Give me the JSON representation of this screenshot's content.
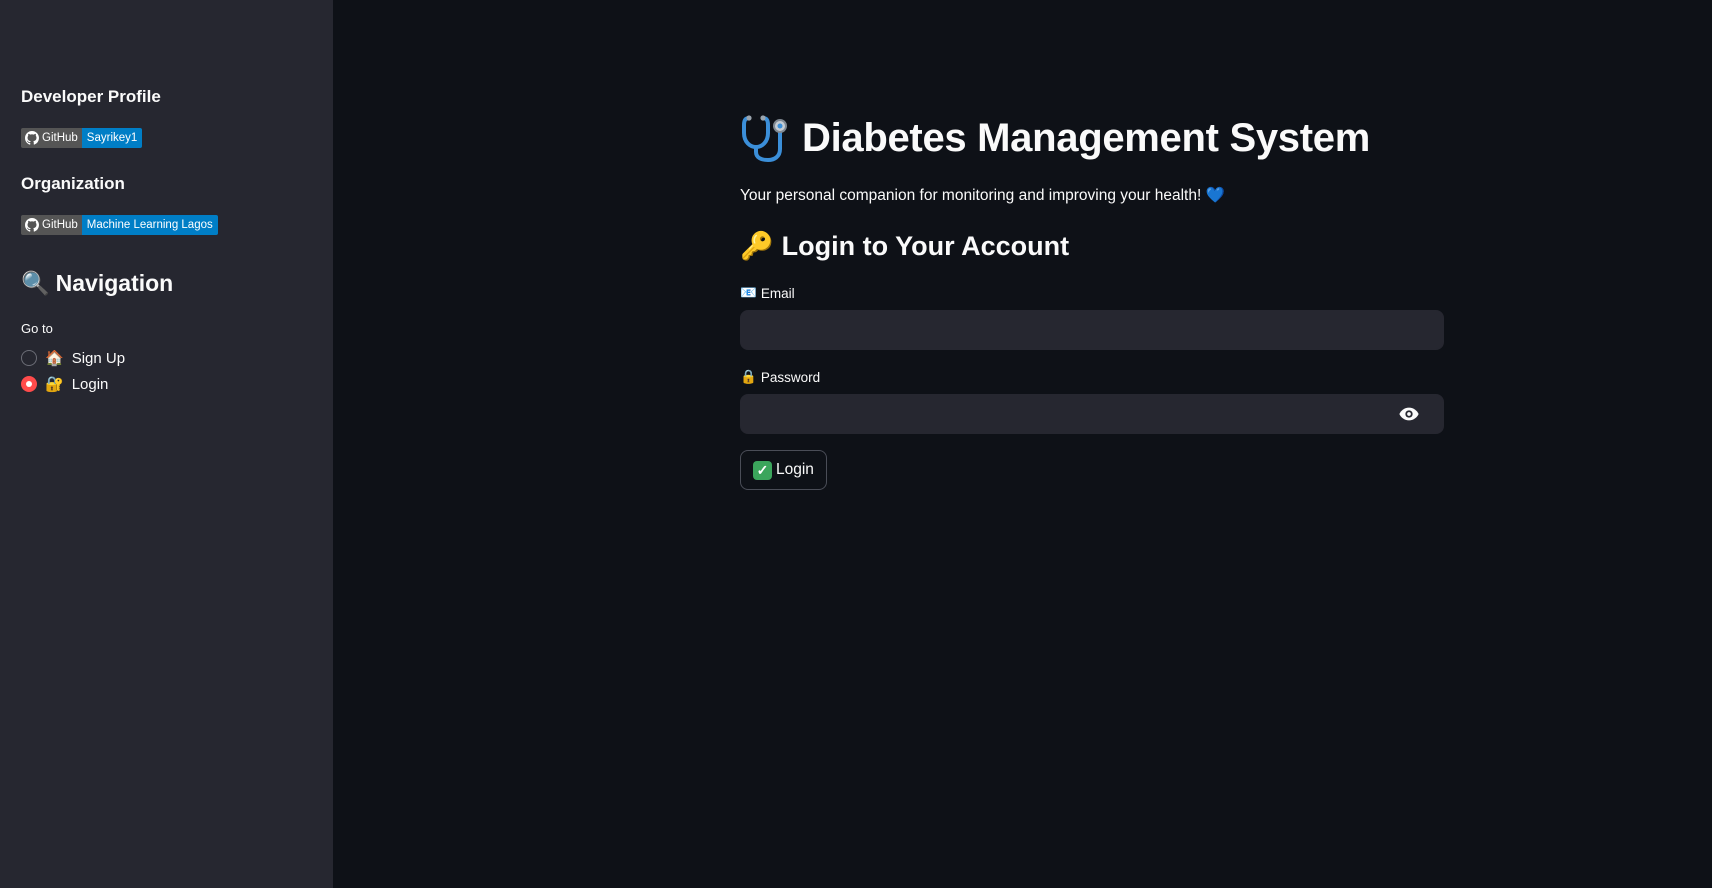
{
  "sidebar": {
    "developer_heading": "Developer Profile",
    "developer_badge": {
      "label": "GitHub",
      "value": "Sayrikey1"
    },
    "org_heading": "Organization",
    "org_badge": {
      "label": "GitHub",
      "value": "Machine Learning Lagos"
    },
    "nav_icon": "🔍",
    "nav_heading": "Navigation",
    "goto_label": "Go to",
    "options": [
      {
        "icon": "🏠",
        "label": "Sign Up",
        "selected": false
      },
      {
        "icon": "🔐",
        "label": "Login",
        "selected": true
      }
    ]
  },
  "main": {
    "title_icon": "stethoscope-icon",
    "title": "Diabetes Management System",
    "subtitle": "Your personal companion for monitoring and improving your health!",
    "subtitle_emoji": "💙",
    "section_icon": "🔑",
    "section_title": "Login to Your Account",
    "email_icon": "📧",
    "email_label": "Email",
    "email_value": "",
    "password_icon": "🔒",
    "password_label": "Password",
    "password_value": "",
    "login_button_check": "✓",
    "login_button_label": "Login"
  },
  "colors": {
    "sidebar_bg": "#262730",
    "main_bg": "#0e1117",
    "badge_label_bg": "#555555",
    "badge_value_bg": "#007ec6",
    "radio_selected": "#ff4b4b"
  }
}
